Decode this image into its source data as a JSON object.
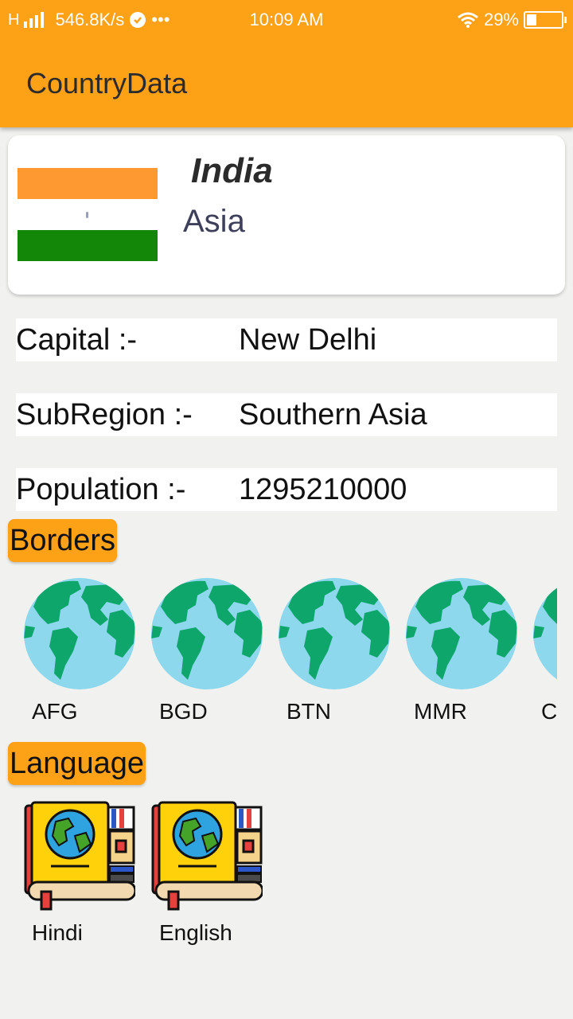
{
  "status_bar": {
    "network": "H",
    "speed": "546.8K/s",
    "dots": "•••",
    "time": "10:09 AM",
    "battery": "29%",
    "battery_level": 0.29
  },
  "app_bar": {
    "title": "CountryData"
  },
  "country": {
    "name": "India",
    "region": "Asia",
    "flag_colors": [
      "#fe9932",
      "#ffffff",
      "#138808"
    ]
  },
  "details": [
    {
      "label": "Capital :-",
      "value": "New Delhi"
    },
    {
      "label": "SubRegion :-",
      "value": "Southern Asia"
    },
    {
      "label": "Population :-",
      "value": "1295210000"
    }
  ],
  "borders": {
    "title": "Borders",
    "icon": "globe-icon",
    "items": [
      "AFG",
      "BGD",
      "BTN",
      "MMR",
      "C"
    ]
  },
  "languages": {
    "title": "Language",
    "icon": "language-book-icon",
    "items": [
      "Hindi",
      "English"
    ]
  },
  "colors": {
    "accent": "#fda117",
    "background": "#f1f2f0"
  }
}
